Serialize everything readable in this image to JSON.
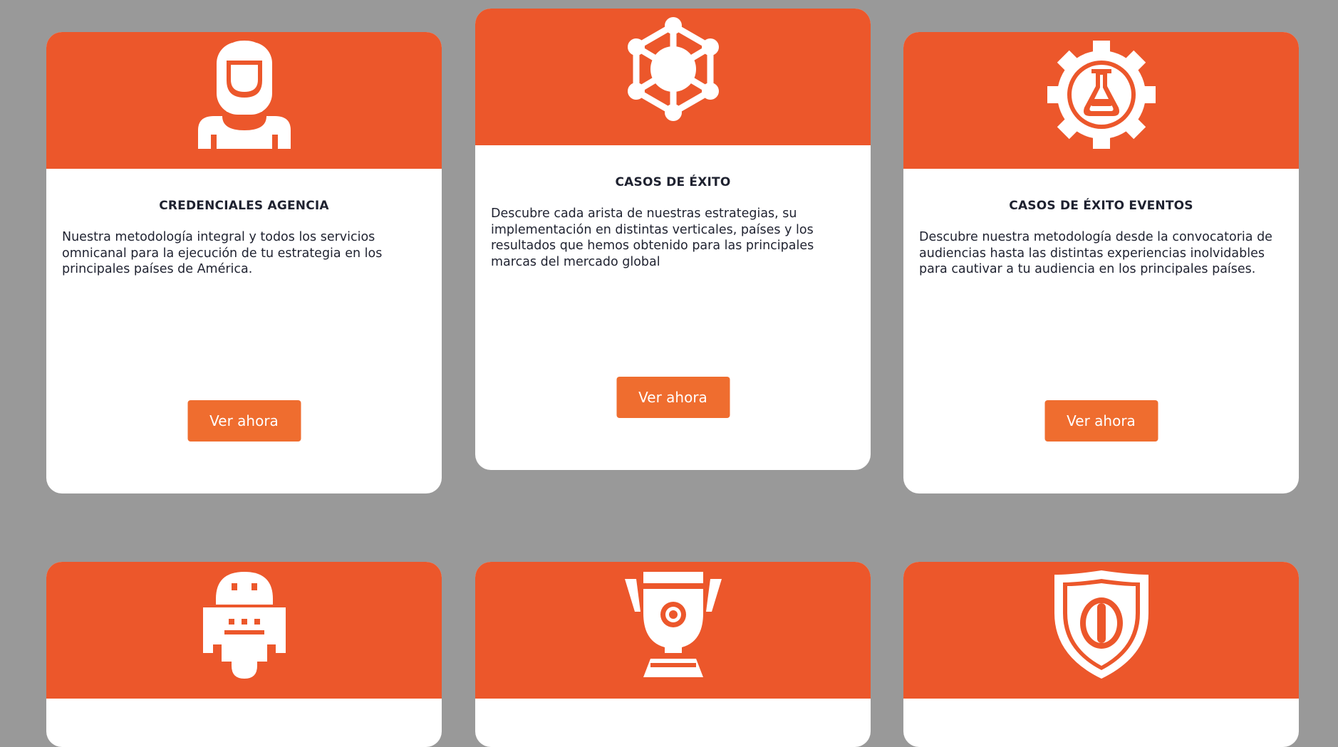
{
  "colors": {
    "background": "#999999",
    "card_header": "#ec572b",
    "button": "#ef6d2f",
    "title_text": "#1f2230"
  },
  "cards": [
    {
      "icon": "astronaut-icon",
      "title": "CREDENCIALES AGENCIA",
      "description": "Nuestra metodología integral y todos los servicios omnicanal para la ejecución de tu estrategia en los principales países de América.",
      "button": "Ver ahora"
    },
    {
      "icon": "network-molecule-icon",
      "title": "CASOS DE ÉXITO",
      "description": "Descubre cada arista de nuestras estrategias, su implementación en distintas verticales, países y los resultados que hemos obtenido para las principales marcas del mercado global",
      "button": "Ver ahora"
    },
    {
      "icon": "gear-flask-icon",
      "title": "CASOS DE ÉXITO EVENTOS",
      "description": "Descubre nuestra metodología desde la convocatoria de audiencias hasta las distintas experiencias inolvidables para cautivar a tu audiencia en los principales países.",
      "button": "Ver ahora"
    },
    {
      "icon": "robot-icon"
    },
    {
      "icon": "trophy-icon"
    },
    {
      "icon": "shield-icon"
    }
  ]
}
